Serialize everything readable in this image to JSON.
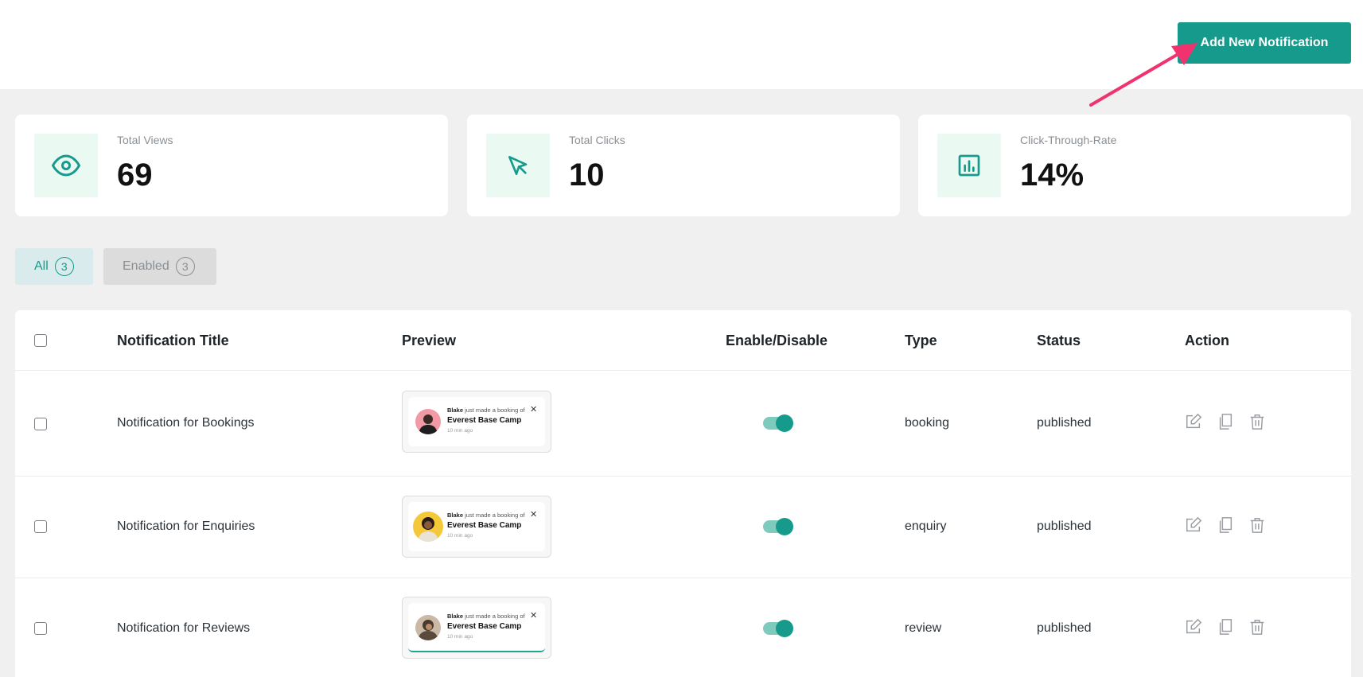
{
  "header": {
    "add_button_label": "Add New Notification"
  },
  "stats": [
    {
      "label": "Total Views",
      "value": "69",
      "icon": "eye-icon"
    },
    {
      "label": "Total Clicks",
      "value": "10",
      "icon": "cursor-icon"
    },
    {
      "label": "Click-Through-Rate",
      "value": "14%",
      "icon": "bar-chart-icon"
    }
  ],
  "filters": [
    {
      "label": "All",
      "count": "3"
    },
    {
      "label": "Enabled",
      "count": "3"
    }
  ],
  "table": {
    "columns": [
      "Notification Title",
      "Preview",
      "Enable/Disable",
      "Type",
      "Status",
      "Action"
    ],
    "rows": [
      {
        "title": "Notification for Bookings",
        "type": "booking",
        "status": "published",
        "enabled": true,
        "preview": {
          "name": "Blake",
          "text": "just made a booking of",
          "place": "Everest Base Camp",
          "time": "10 min ago"
        }
      },
      {
        "title": "Notification for Enquiries",
        "type": "enquiry",
        "status": "published",
        "enabled": true,
        "preview": {
          "name": "Blake",
          "text": "just made a booking of",
          "place": "Everest Base Camp",
          "time": "10 min ago"
        }
      },
      {
        "title": "Notification for Reviews",
        "type": "review",
        "status": "published",
        "enabled": true,
        "preview": {
          "name": "Blake",
          "text": "just made a booking of",
          "place": "Everest Base Camp",
          "time": "10 min ago"
        }
      }
    ]
  },
  "colors": {
    "accent": "#159a8c",
    "arrow": "#f0326e",
    "icon_bg": "#eafaf3"
  }
}
